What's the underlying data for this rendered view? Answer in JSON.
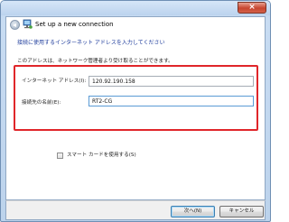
{
  "window": {
    "title": "Set up a new connection",
    "close_glyph": "×"
  },
  "heading": "接続に使用するインターネット アドレスを入力してください",
  "description": "このアドレスは、ネットワーク管理者より受け取ることができます。",
  "fields": {
    "address": {
      "label": "インターネット アドレス(I):",
      "value": "120.92.190.158"
    },
    "destination_name": {
      "label": "接続先の名前(E):",
      "value": "RT2-CG"
    }
  },
  "smartcard": {
    "label": "スマート カードを使用する(S)",
    "checked": false
  },
  "buttons": {
    "next": "次へ(N)",
    "cancel": "キャンセル"
  },
  "colors": {
    "heading": "#1f3d9c",
    "highlight": "#e0262a"
  },
  "icons": {
    "back": "back-arrow-icon",
    "network": "network-connection-icon"
  }
}
